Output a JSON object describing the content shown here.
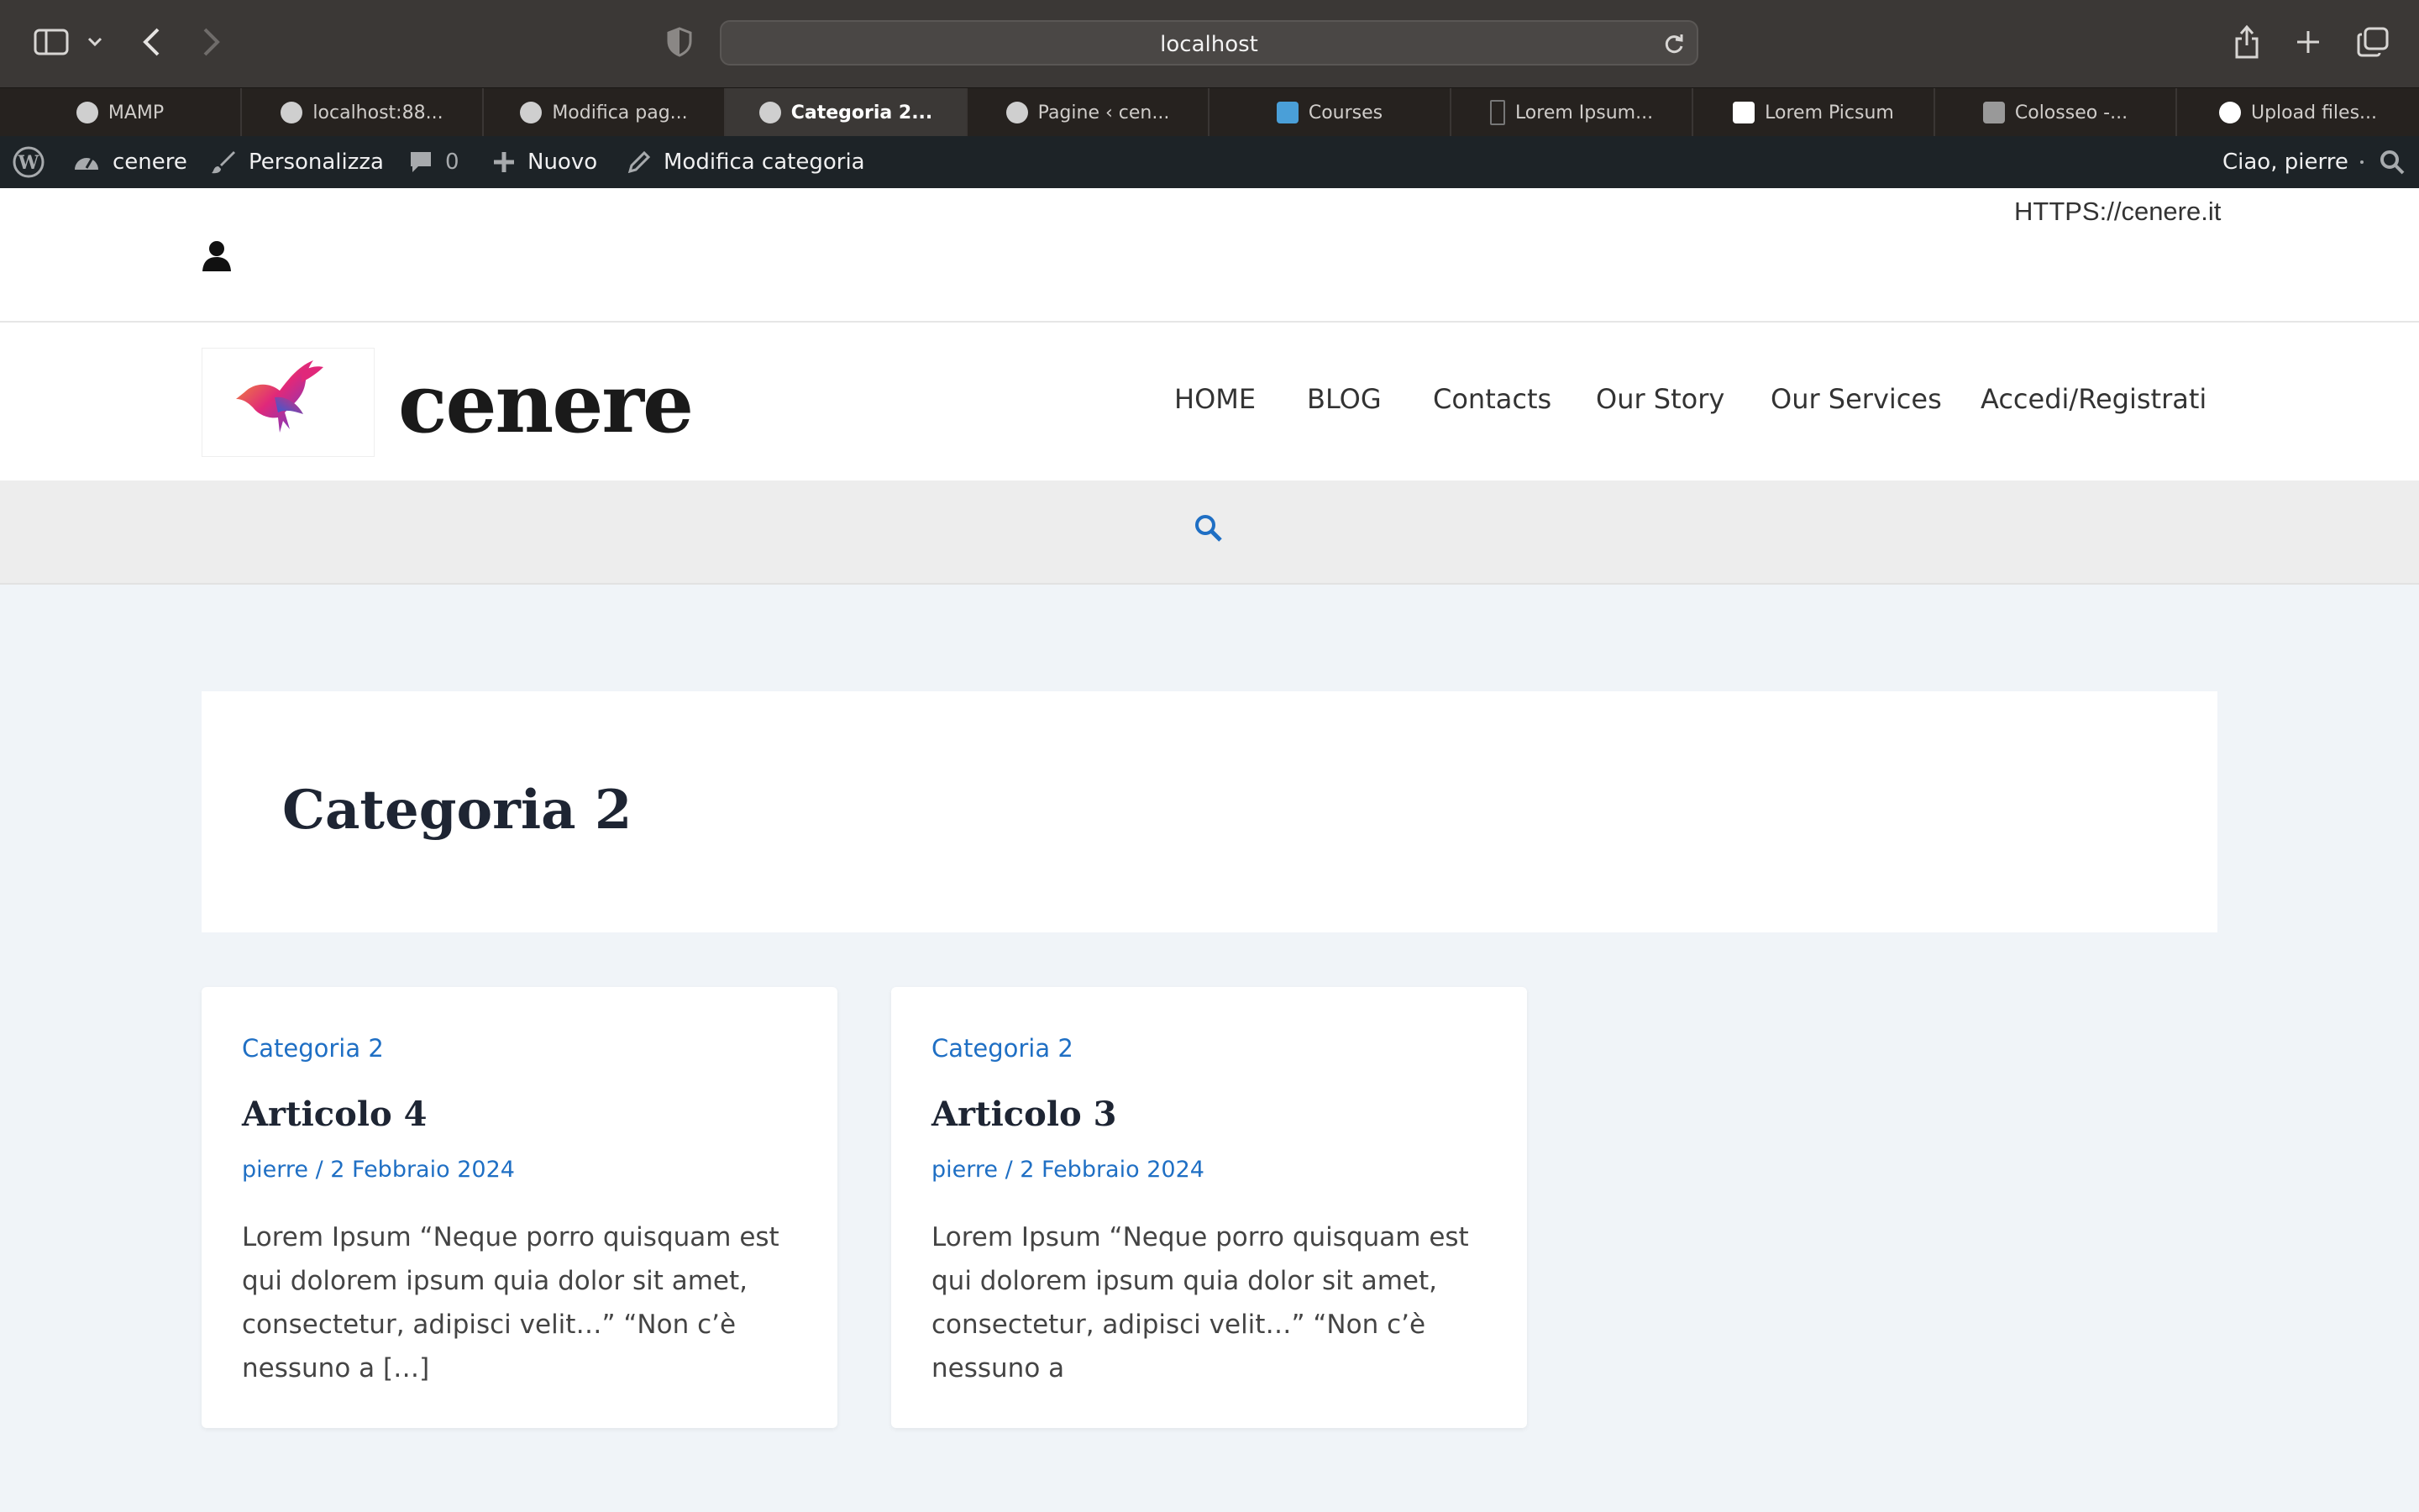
{
  "browser": {
    "url": "localhost",
    "tabs": [
      {
        "label": "MAMP",
        "active": false
      },
      {
        "label": "localhost:88...",
        "active": false
      },
      {
        "label": "Modifica pag...",
        "active": false
      },
      {
        "label": "Categoria 2...",
        "active": true
      },
      {
        "label": "Pagine ‹ cen...",
        "active": false
      },
      {
        "label": "Courses",
        "active": false
      },
      {
        "label": "Lorem Ipsum...",
        "active": false
      },
      {
        "label": "Lorem Picsum",
        "active": false
      },
      {
        "label": "Colosseo -...",
        "active": false
      },
      {
        "label": "Upload files...",
        "active": false
      }
    ]
  },
  "adminbar": {
    "site": "cenere",
    "customize": "Personalizza",
    "comments": "0",
    "new": "Nuovo",
    "edit": "Modifica categoria",
    "greeting": "Ciao, pierre"
  },
  "topbar": {
    "url_text": "HTTPS://cenere.it"
  },
  "header": {
    "brand": "cenere",
    "nav": [
      "HOME",
      "BLOG",
      "Contacts",
      "Our Story",
      "Our Services",
      "Accedi/Registrati"
    ]
  },
  "archive": {
    "title": "Categoria 2"
  },
  "posts": [
    {
      "category": "Categoria 2",
      "title": "Articolo 4",
      "meta": "pierre / 2 Febbraio 2024",
      "excerpt": "Lorem Ipsum “Neque porro quisquam est qui dolorem ipsum quia dolor sit amet, consectetur, adipisci velit…” “Non c’è nessuno a […]"
    },
    {
      "category": "Categoria 2",
      "title": "Articolo 3",
      "meta": "pierre / 2 Febbraio 2024",
      "excerpt": "Lorem Ipsum “Neque porro quisquam est qui dolorem ipsum quia dolor sit amet, consectetur, adipisci velit…” “Non c’è nessuno a"
    }
  ],
  "colors": {
    "accent": "#1f6fc4",
    "adminbar": "#1d2327",
    "page_bg": "#f0f4f8"
  }
}
